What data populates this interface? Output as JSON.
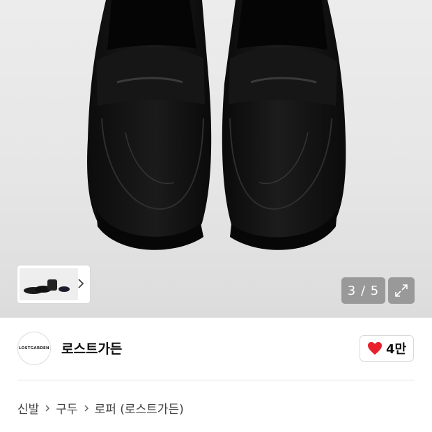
{
  "gallery": {
    "counter": "3 / 5",
    "thumbnail_alt_icon": "shoe-thumbnail",
    "next_icon": "chevron-right-icon",
    "expand_icon": "expand-arrows-icon"
  },
  "brand": {
    "logo_text": "LOSTGARDEN",
    "name": "로스트가든",
    "likes": "4만",
    "like_color": "#e8202c"
  },
  "breadcrumb": {
    "items": [
      "신발",
      "구두",
      "로퍼 (로스트가든)"
    ]
  }
}
